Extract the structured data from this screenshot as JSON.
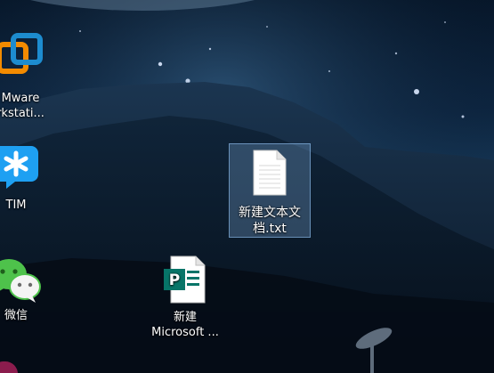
{
  "desktop": {
    "icons": [
      {
        "label": "Mware\nrkstati...",
        "icon": "vmware-icon",
        "selected": false
      },
      {
        "label": "TIM",
        "icon": "tim-icon",
        "selected": false
      },
      {
        "label": "微信",
        "icon": "wechat-icon",
        "selected": false
      },
      {
        "label": "新建文本文档.txt",
        "icon": "text-file-icon",
        "selected": true
      },
      {
        "label": "新建\nMicrosoft ...",
        "icon": "publisher-icon",
        "selected": false
      }
    ]
  },
  "colors": {
    "vmware_orange": "#f38b00",
    "vmware_blue": "#1d8ccf",
    "tim_blue": "#1ea0f2",
    "wechat_green": "#4ec24b",
    "publisher_teal": "#077568",
    "selection": "#99ccff"
  }
}
